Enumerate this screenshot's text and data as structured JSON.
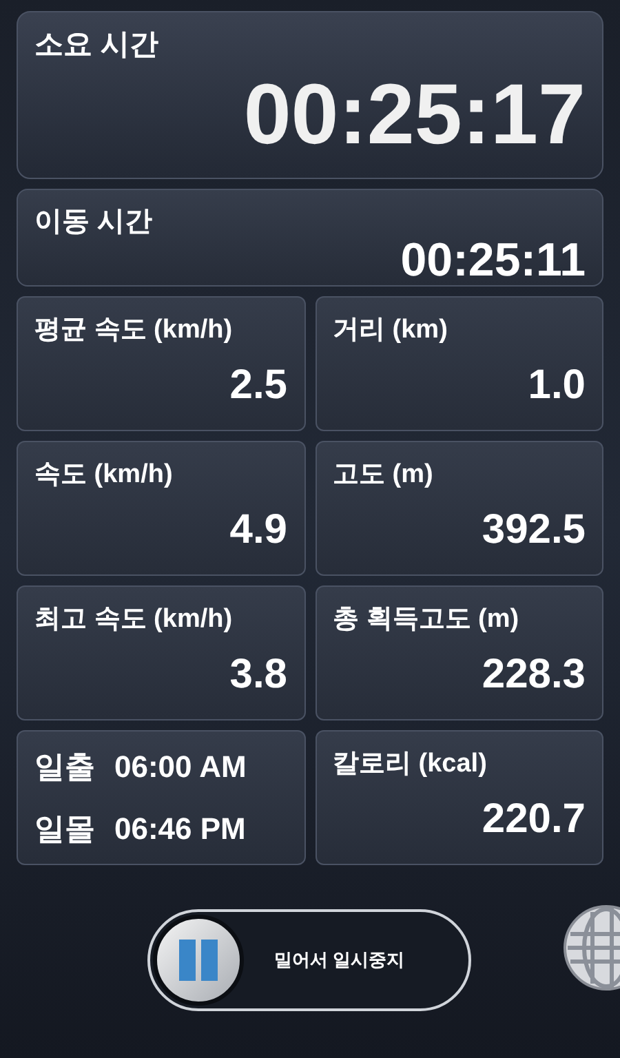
{
  "total_time": {
    "label": "소요 시간",
    "value": "00:25:17"
  },
  "moving_time": {
    "label": "이동 시간",
    "value": "00:25:11"
  },
  "stats": [
    {
      "kind": "stat",
      "label": "평균 속도 (km/h)",
      "value": "2.5"
    },
    {
      "kind": "stat",
      "label": "거리 (km)",
      "value": "1.0"
    },
    {
      "kind": "stat",
      "label": "속도 (km/h)",
      "value": "4.9"
    },
    {
      "kind": "stat",
      "label": "고도 (m)",
      "value": "392.5"
    },
    {
      "kind": "stat",
      "label": "최고 속도 (km/h)",
      "value": "3.8"
    },
    {
      "kind": "stat",
      "label": "총 획득고도 (m)",
      "value": "228.3"
    },
    {
      "kind": "sun",
      "rows": [
        {
          "label": "일출",
          "time": "06:00 AM"
        },
        {
          "label": "일몰",
          "time": "06:46 PM"
        }
      ]
    },
    {
      "kind": "stat",
      "label": "칼로리 (kcal)",
      "value": "220.7"
    }
  ],
  "slider": {
    "label": "밀어서 일시중지",
    "level": 0
  }
}
